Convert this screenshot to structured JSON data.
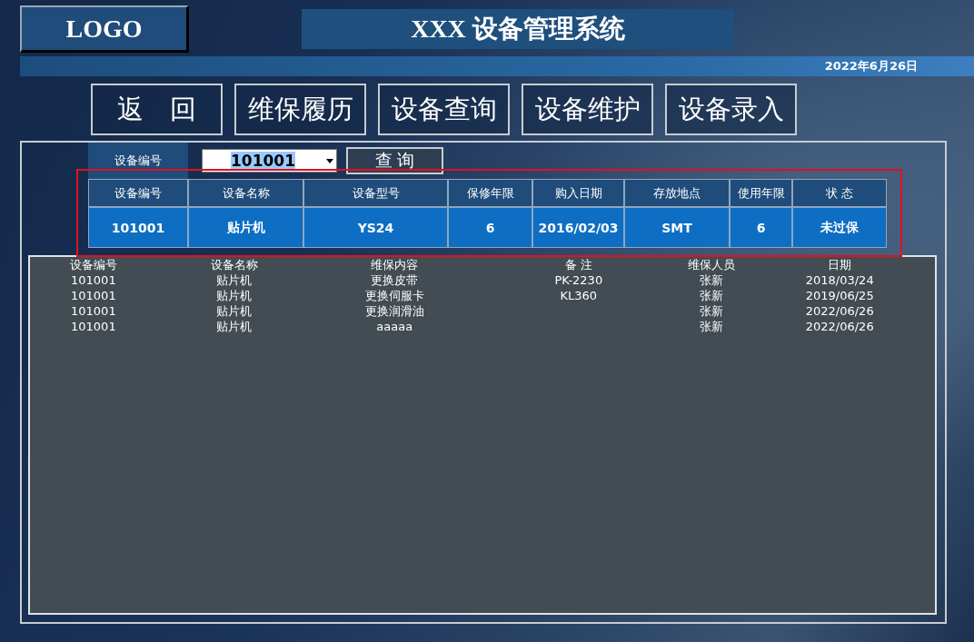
{
  "header": {
    "logo": "LOGO",
    "title": "XXX 设备管理系统",
    "date": "2022年6月26日"
  },
  "nav_buttons": [
    "返　回",
    "维保履历",
    "设备查询",
    "设备维护",
    "设备录入"
  ],
  "query": {
    "label": "设备编号",
    "value": "101001",
    "button": "查 询"
  },
  "info_table": {
    "columns": [
      "设备编号",
      "设备名称",
      "设备型号",
      "保修年限",
      "购入日期",
      "存放地点",
      "使用年限",
      "状 态"
    ],
    "row": [
      "101001",
      "贴片机",
      "YS24",
      "6",
      "2016/02/03",
      "SMT",
      "6",
      "未过保"
    ]
  },
  "history": {
    "columns": [
      "设备编号",
      "设备名称",
      "维保内容",
      "备 注",
      "维保人员",
      "日期"
    ],
    "rows": [
      [
        "101001",
        "贴片机",
        "更换皮带",
        "PK-2230",
        "张新",
        "2018/03/24"
      ],
      [
        "101001",
        "贴片机",
        "更换伺服卡",
        "KL360",
        "张新",
        "2019/06/25"
      ],
      [
        "101001",
        "贴片机",
        "更换润滑油",
        "",
        "张新",
        "2022/06/26"
      ],
      [
        "101001",
        "贴片机",
        "aaaaa",
        "",
        "张新",
        "2022/06/26"
      ]
    ]
  }
}
